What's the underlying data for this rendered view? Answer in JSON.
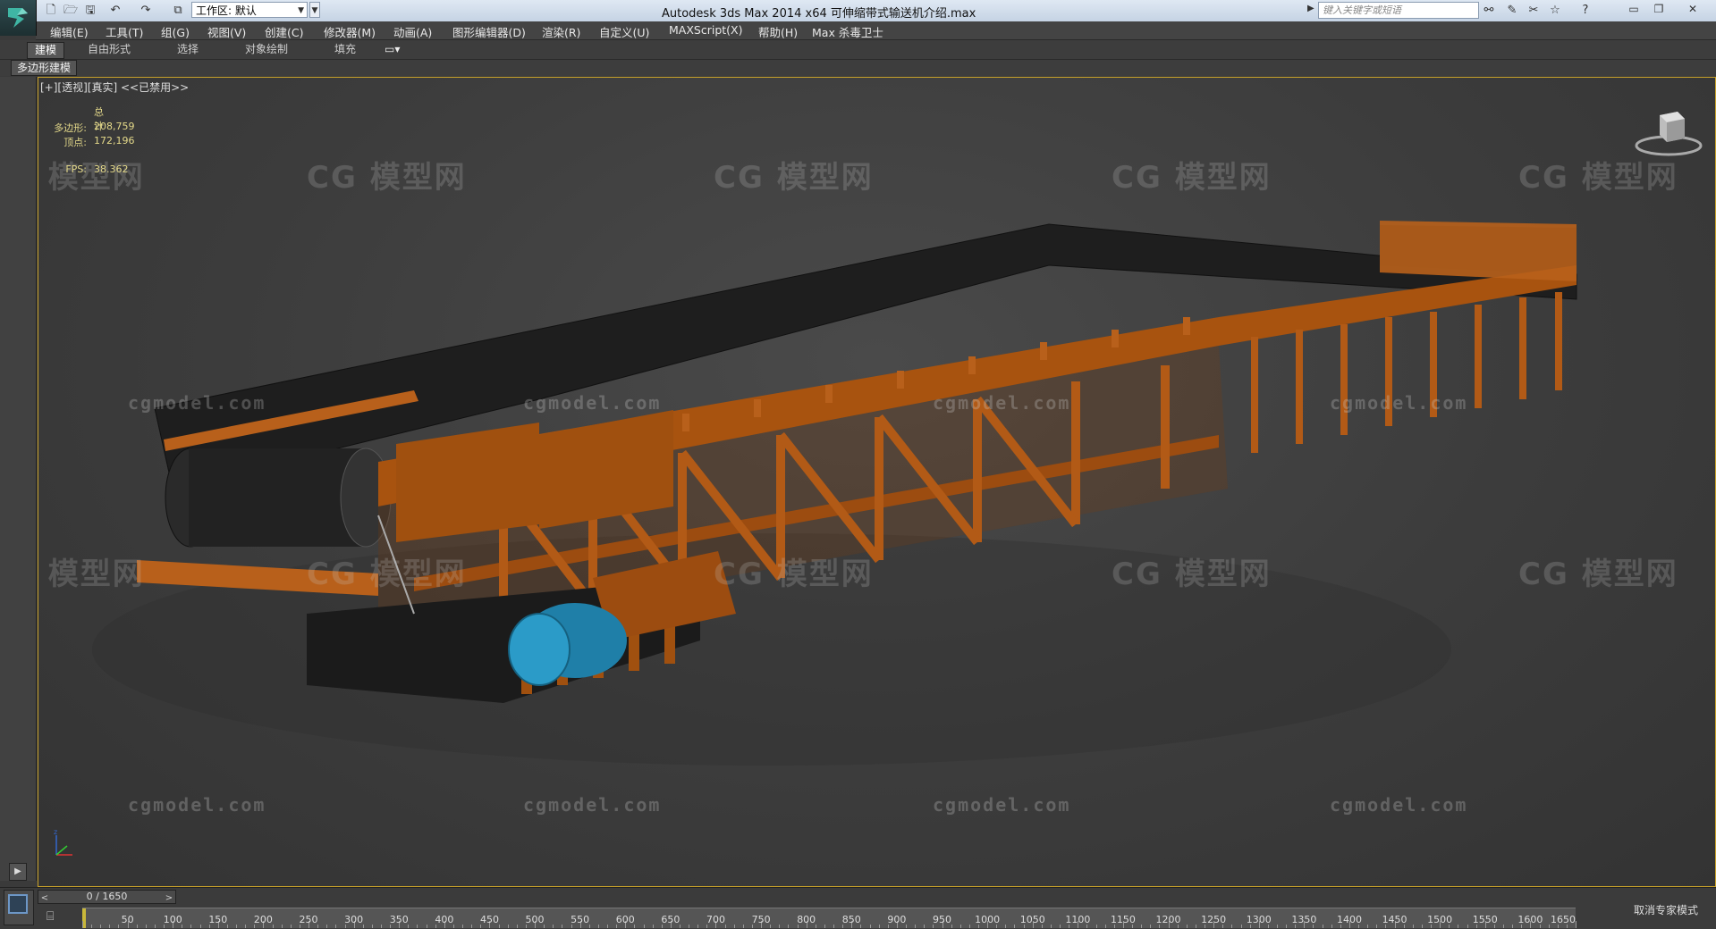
{
  "titlebar": {
    "workspace_label": "工作区: 默认",
    "window_title": "Autodesk 3ds Max  2014 x64     可伸缩带式输送机介绍.max",
    "search_placeholder": "键入关键字或短语"
  },
  "menu": [
    "编辑(E)",
    "工具(T)",
    "组(G)",
    "视图(V)",
    "创建(C)",
    "修改器(M)",
    "动画(A)",
    "图形编辑器(D)",
    "渲染(R)",
    "自定义(U)",
    "MAXScript(X)",
    "帮助(H)",
    "Max 杀毒卫士"
  ],
  "ribbon": {
    "tabs": [
      "建模",
      "自由形式",
      "选择",
      "对象绘制",
      "填充"
    ],
    "active_tab": "建模",
    "panel_label": "多边形建模"
  },
  "viewport": {
    "label": "[+][透视][真实] <<已禁用>>",
    "stats": {
      "header": "总计",
      "polys_label": "多边形:",
      "polys_value": "208,759",
      "verts_label": "顶点:",
      "verts_value": "172,196",
      "fps_label": "FPS:",
      "fps_value": "38.362"
    },
    "watermark_logo": "CG 模型网",
    "watermark_site": "cgmodel.com",
    "accent_color": "#c8a22a",
    "model_color": "#b35a14",
    "motor_color": "#2b9bc8"
  },
  "timeline": {
    "frame_label": "0 / 1650",
    "ticks": [
      50,
      100,
      150,
      200,
      250,
      300,
      350,
      400,
      450,
      500,
      550,
      600,
      650,
      700,
      750,
      800,
      850,
      900,
      950,
      1000,
      1050,
      1100,
      1150,
      1200,
      1250,
      1300,
      1350,
      1400,
      1450,
      1500,
      1550,
      1600,
      1650
    ],
    "tick_max": 1650,
    "status_text": "取消专家模式"
  }
}
